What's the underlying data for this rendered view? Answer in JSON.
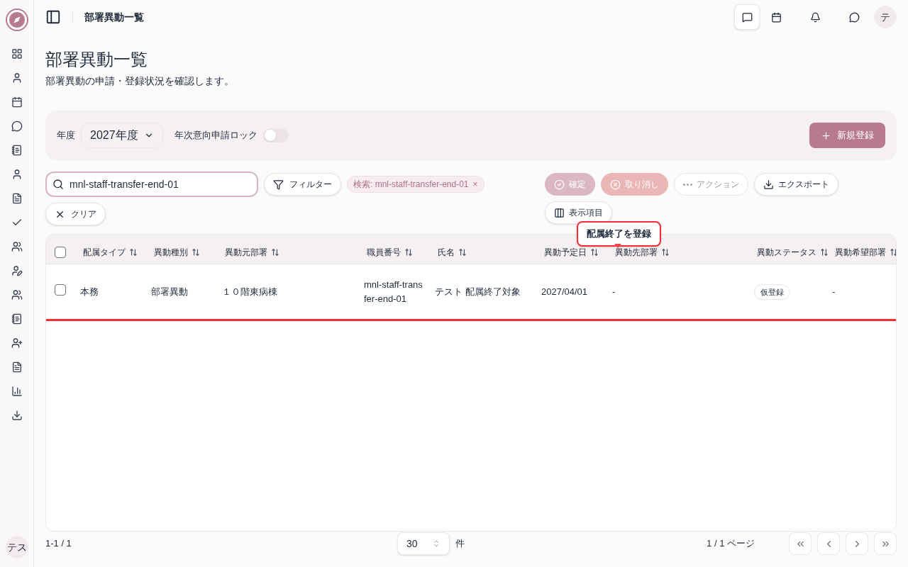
{
  "header": {
    "title": "部署異動一覧",
    "avatar": "テ"
  },
  "sidebar": {
    "avatar": "テス"
  },
  "page": {
    "title": "部署異動一覧",
    "subtitle": "部署異動の申請・登録状況を確認します。"
  },
  "settings": {
    "year_label": "年度",
    "year_value": "2027年度",
    "lock_label": "年次意向申請ロック",
    "lock_on": false,
    "new_button": "新規登録"
  },
  "search": {
    "value": "mnl-staff-transfer-end-01"
  },
  "filter_button": "フィルター",
  "chip": {
    "label": "検索: mnl-staff-transfer-end-01",
    "remove": "×"
  },
  "clear_button": "クリア",
  "actions": [
    {
      "kind": "confirm",
      "label": "確定",
      "disabled": true
    },
    {
      "kind": "cancel",
      "label": "取り消し",
      "disabled": true
    },
    {
      "kind": "menu",
      "label": "アクション",
      "disabled": true
    },
    {
      "kind": "export",
      "label": "エクスポート",
      "disabled": false
    },
    {
      "kind": "columns",
      "label": "表示項目",
      "disabled": false
    }
  ],
  "tooltip": "配属終了を登録",
  "table": {
    "all_checked": false,
    "columns": [
      "配属タイプ",
      "異動種別",
      "異動元部署",
      "職員番号",
      "氏名",
      "異動予定日",
      "異動先部署",
      "異動ステータス",
      "異動希望部署"
    ],
    "rows": [
      {
        "checked": false,
        "highlighted": true,
        "cells": [
          "本務",
          "部署異動",
          "１０階東病棟",
          "mnl-staff-transfer-end-01",
          "テスト 配属終了対象",
          "2027/04/01",
          "-",
          "仮登録",
          "-"
        ]
      }
    ]
  },
  "footer": {
    "count": "1-1 / 1",
    "page_size": "30",
    "unit": "件",
    "pages": "1 / 1 ページ"
  }
}
